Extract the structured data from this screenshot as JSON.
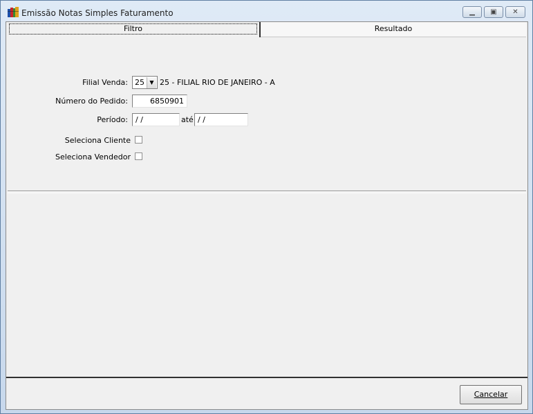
{
  "window": {
    "title": "Emissão Notas Simples Faturamento",
    "controls": {
      "minimize": "▭",
      "restore": "▣",
      "close": "✕"
    }
  },
  "tabs": [
    {
      "label": "Filtro",
      "active": true
    },
    {
      "label": "Resultado",
      "active": false
    }
  ],
  "form": {
    "filial_label": "Filial Venda:",
    "filial_value": "25",
    "filial_desc": "25 - FILIAL RIO DE JANEIRO - A",
    "pedido_label": "Número do Pedido:",
    "pedido_value": "6850901",
    "periodo_label": "Período:",
    "periodo_from": " / /",
    "periodo_ate": "até",
    "periodo_to": " / /",
    "cliente_label": "Seleciona Cliente",
    "cliente_checked": false,
    "vendedor_label": "Seleciona Vendedor",
    "vendedor_checked": false
  },
  "footer": {
    "cancel_label": "Cancelar"
  },
  "icons": {
    "app": "books-icon",
    "dropdown": "chevron-down-icon"
  },
  "colors": {
    "titlebar": "#c7d8ec",
    "panel": "#f0f0f0"
  }
}
